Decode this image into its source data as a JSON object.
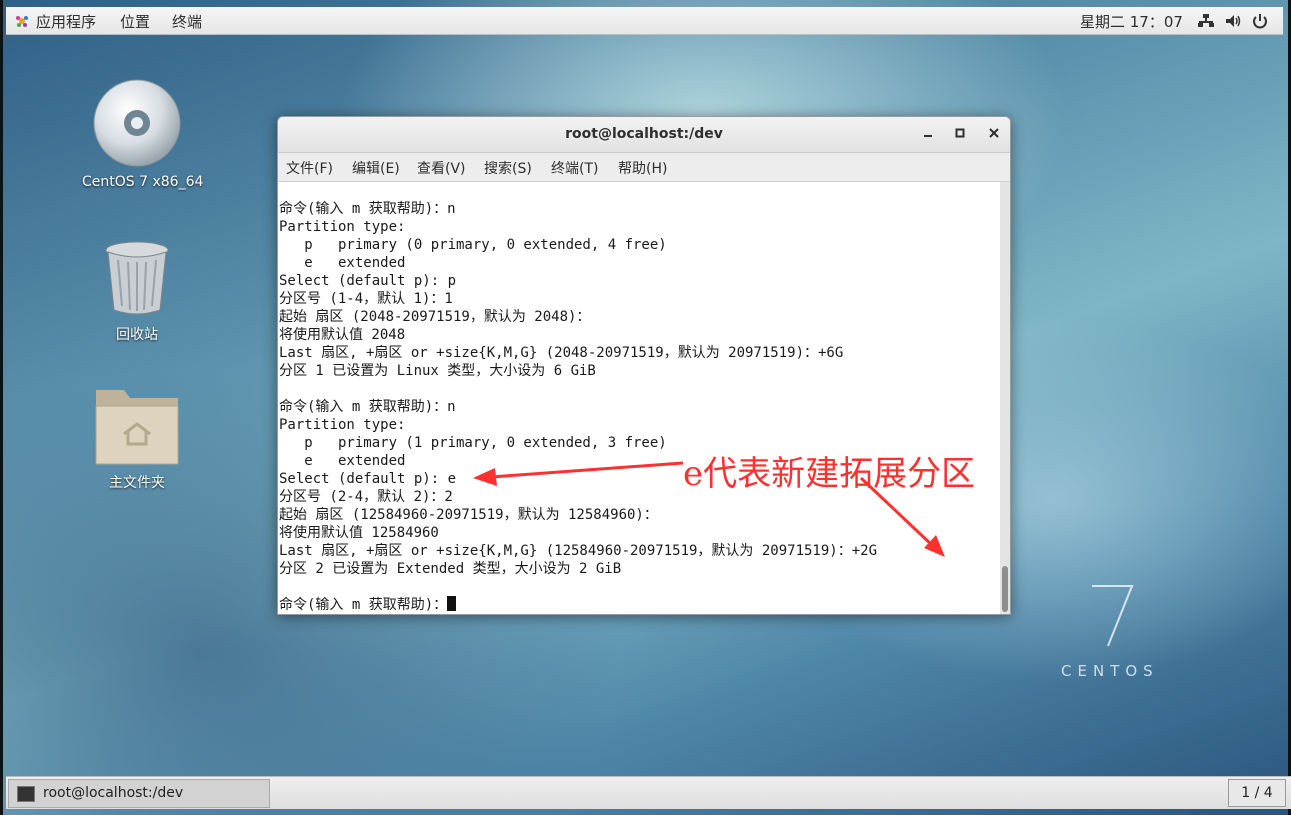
{
  "topbar": {
    "menus": [
      "应用程序",
      "位置",
      "终端"
    ],
    "clock": "星期二 17：07",
    "tray_icons": [
      "network-icon",
      "volume-icon",
      "power-icon"
    ]
  },
  "desktop": {
    "icons": [
      {
        "label": "CentOS 7 x86_64",
        "icon": "dvd-disc-icon"
      },
      {
        "label": "回收站",
        "icon": "trash-icon"
      },
      {
        "label": "主文件夹",
        "icon": "home-folder-icon"
      }
    ],
    "logo_number": "7",
    "logo_word": "CENTOS"
  },
  "window": {
    "title": "root@localhost:/dev",
    "menu": [
      "文件(F)",
      "编辑(E)",
      "查看(V)",
      "搜索(S)",
      "终端(T)",
      "帮助(H)"
    ],
    "lines": [
      "命令(输入 m 获取帮助)：n",
      "Partition type:",
      "   p   primary (0 primary, 0 extended, 4 free)",
      "   e   extended",
      "Select (default p): p",
      "分区号 (1-4，默认 1)：1",
      "起始 扇区 (2048-20971519，默认为 2048)：",
      "将使用默认值 2048",
      "Last 扇区, +扇区 or +size{K,M,G} (2048-20971519，默认为 20971519)：+6G",
      "分区 1 已设置为 Linux 类型，大小设为 6 GiB",
      "",
      "命令(输入 m 获取帮助)：n",
      "Partition type:",
      "   p   primary (1 primary, 0 extended, 3 free)",
      "   e   extended",
      "Select (default p): e",
      "分区号 (2-4，默认 2)：2",
      "起始 扇区 (12584960-20971519，默认为 12584960)：",
      "将使用默认值 12584960",
      "Last 扇区, +扇区 or +size{K,M,G} (12584960-20971519，默认为 20971519)：+2G",
      "分区 2 已设置为 Extended 类型，大小设为 2 GiB",
      ""
    ],
    "prompt": "命令(输入 m 获取帮助)："
  },
  "annotation": {
    "text": "e代表新建拓展分区",
    "color": "#ff3030"
  },
  "taskbar": {
    "task_label": "root@localhost:/dev",
    "workspace": "1 / 4"
  }
}
